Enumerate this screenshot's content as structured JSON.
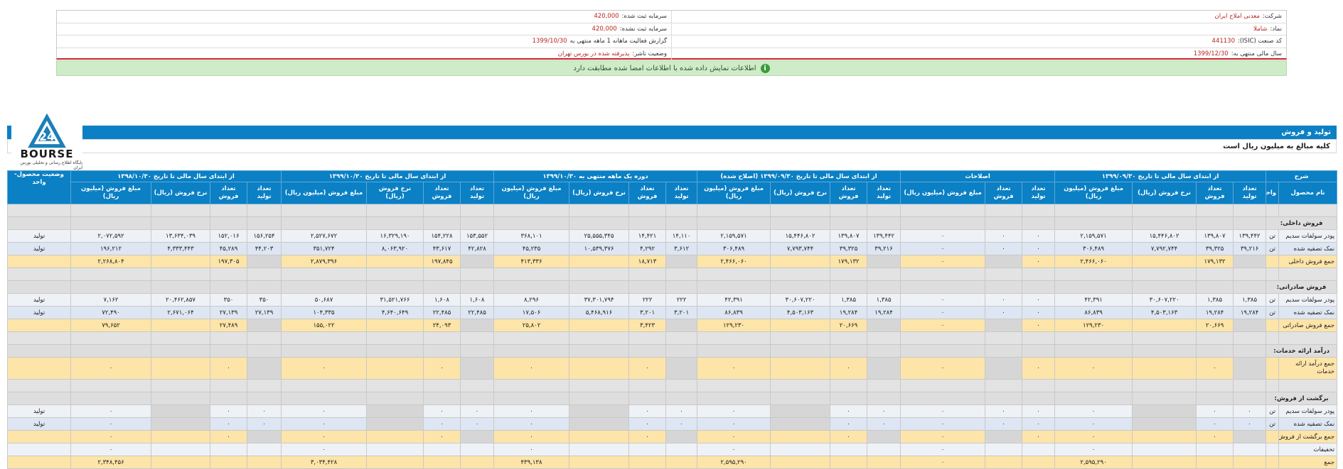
{
  "info": {
    "company_label": "شرکت:",
    "company_value": "معدنی املاح ایران",
    "capital_reg_label": "سرمایه ثبت شده:",
    "capital_reg_value": "420,000",
    "symbol_label": "نماد:",
    "symbol_value": "شاملا",
    "capital_unreg_label": "سرمایه ثبت نشده:",
    "capital_unreg_value": "420,000",
    "isic_label": "کد صنعت (ISIC):",
    "isic_value": "441130",
    "report_label": "گزارش فعالیت ماهانه 1 ماهه منتهی به",
    "report_value": "1399/10/30",
    "fiscal_label": "سال مالی منتهی به:",
    "fiscal_value": "1399/12/30",
    "status_label": "وضعیت ناشر:",
    "status_value": "پذیرفته شده در بورس تهران"
  },
  "notice": "اطلاعات نمایش داده شده با اطلاعات امضا شده مطابقت دارد",
  "logo": {
    "word": "BOURSE",
    "subtitle": "پایگاه اطلاع رسانی و تحلیلی بورس ایران",
    "glyph": "24"
  },
  "section": {
    "title": "تولید و فروش",
    "note": "کلیه مبالغ به میلیون ریال است"
  },
  "table": {
    "group_headers": {
      "desc": "شرح",
      "g1": "از ابتدای سال مالی تا تاریخ ۱۳۹۹/۰۹/۳۰",
      "g2": "اصلاحات",
      "g3": "از ابتدای سال مالی تا تاریخ ۱۳۹۹/۰۹/۳۰ (اصلاح شده)",
      "g4": "دوره یک ماهه منتهی به ۱۳۹۹/۱۰/۳۰",
      "g5": "از ابتدای سال مالی تا تاریخ ۱۳۹۹/۱۰/۳۰",
      "g6": "از ابتدای سال مالی تا تاریخ ۱۳۹۸/۱۰/۳۰",
      "status": "وضعیت محصول-واحد"
    },
    "sub_headers": {
      "product": "نام محصول",
      "unit": "واحد",
      "prod_qty": "تعداد تولید",
      "sale_qty": "تعداد فروش",
      "rate": "نرخ فروش (ریال)",
      "amount": "مبلغ فروش (میلیون ریال)"
    },
    "categories": {
      "domestic": "فروش داخلی:",
      "export": "فروش صادراتی:",
      "services": "درآمد ارائه خدمات:",
      "returns": "برگشت از فروش:"
    },
    "rows": {
      "dom1": [
        "پودر سولفات سدیم",
        "تن",
        "۱۳۹,۴۴۲",
        "۱۳۹,۸۰۷",
        "۱۵,۴۴۶,۸۰۲",
        "۲,۱۵۹,۵۷۱",
        "۰",
        "۰",
        "۰",
        "۱۳۹,۴۴۲",
        "۱۳۹,۸۰۷",
        "۱۵,۴۴۶,۸۰۲",
        "۲,۱۵۹,۵۷۱",
        "۱۴,۱۱۰",
        "۱۴,۴۲۱",
        "۲۵,۵۵۵,۳۴۵",
        "۳۶۸,۱۰۱",
        "۱۵۳,۵۵۲",
        "۱۵۴,۲۲۸",
        "۱۶,۳۲۹,۱۹۰",
        "۲,۵۲۷,۶۷۲",
        "۱۵۶,۲۵۴",
        "۱۵۲,۰۱۶",
        "۱۳,۶۳۴,۰۳۹",
        "۲,۰۷۲,۵۹۲",
        "تولید"
      ],
      "dom2": [
        "نمک تصفیه شده",
        "تن",
        "۳۹,۲۱۶",
        "۳۹,۳۲۵",
        "۷,۷۹۲,۷۴۴",
        "۳۰۶,۴۸۹",
        "۰",
        "۰",
        "۰",
        "۳۹,۲۱۶",
        "۳۹,۳۲۵",
        "۷,۷۹۳,۷۴۴",
        "۳۰۶,۴۸۹",
        "۳,۶۱۲",
        "۴,۲۹۲",
        "۱۰,۵۳۹,۳۷۶",
        "۴۵,۲۳۵",
        "۴۲,۸۲۸",
        "۴۳,۶۱۷",
        "۸,۰۶۳,۹۲۰",
        "۳۵۱,۷۲۴",
        "۴۴,۲۰۳",
        "۴۵,۲۸۹",
        "۴,۳۳۳,۴۴۳",
        "۱۹۶,۲۱۲",
        "تولید"
      ],
      "dom_sum": [
        "جمع فروش داخلی",
        "",
        "",
        "۱۷۹,۱۳۲",
        "",
        "۲,۴۶۶,۰۶۰",
        "۰",
        "",
        "۰",
        "",
        "۱۷۹,۱۳۲",
        "",
        "۲,۴۶۶,۰۶۰",
        "",
        "۱۸,۷۱۳",
        "",
        "۴۱۳,۳۳۶",
        "",
        "۱۹۷,۸۴۵",
        "",
        "۲,۸۷۹,۳۹۶",
        "",
        "۱۹۷,۳۰۵",
        "",
        "۲,۲۶۸,۸۰۴",
        ""
      ],
      "exp1": [
        "پودر سولفات سدیم",
        "تن",
        "۱,۳۸۵",
        "۱,۳۸۵",
        "۳۰,۶۰۷,۲۲۰",
        "۴۲,۳۹۱",
        "۰",
        "۰",
        "۰",
        "۱,۳۸۵",
        "۱,۳۸۵",
        "۳۰,۶۰۷,۲۲۰",
        "۴۲,۳۹۱",
        "۲۲۲",
        "۲۲۲",
        "۳۷,۳۰۱,۷۹۴",
        "۸,۲۹۶",
        "۱,۶۰۸",
        "۱,۶۰۸",
        "۳۱,۵۲۱,۷۶۶",
        "۵۰,۶۸۷",
        "۳۵۰",
        "۳۵۰",
        "۲۰,۴۶۲,۸۵۷",
        "۷,۱۶۲",
        "تولید"
      ],
      "exp2": [
        "نمک تصفیه شده",
        "تن",
        "۱۹,۲۸۴",
        "۱۹,۲۸۴",
        "۴,۵۰۳,۱۶۳",
        "۸۶,۸۳۹",
        "۰",
        "۰",
        "۰",
        "۱۹,۲۸۴",
        "۱۹,۲۸۴",
        "۴,۵۰۳,۱۶۳",
        "۸۶,۸۳۹",
        "۳,۲۰۱",
        "۳,۲۰۱",
        "۵,۴۶۸,۹۱۶",
        "۱۷,۵۰۶",
        "۲۲,۴۸۵",
        "۲۲,۴۸۵",
        "۴,۶۴۰,۶۴۹",
        "۱۰۴,۳۳۵",
        "۲۷,۱۳۹",
        "۲۷,۱۳۹",
        "۲,۶۷۱,۰۶۴",
        "۷۲,۴۹۰",
        "تولید"
      ],
      "exp_sum": [
        "جمع فروش صادراتی",
        "",
        "",
        "۲۰,۶۶۹",
        "",
        "۱۲۹,۲۳۰",
        "۰",
        "",
        "۰",
        "",
        "۲۰,۶۶۹",
        "",
        "۱۲۹,۲۳۰",
        "",
        "۳,۴۲۳",
        "",
        "۲۵,۸۰۲",
        "",
        "۲۴,۰۹۳",
        "",
        "۱۵۵,۰۲۲",
        "",
        "۲۷,۴۸۹",
        "",
        "۷۹,۶۵۲",
        ""
      ],
      "srv_sum": [
        "جمع درآمد ارائه خدمات",
        "",
        "",
        "۰",
        "",
        "۰",
        "۰",
        "",
        "۰",
        "",
        "۰",
        "",
        "۰",
        "",
        "۰",
        "",
        "۰",
        "",
        "۰",
        "",
        "۰",
        "",
        "۰",
        "",
        "۰",
        ""
      ],
      "ret1": [
        "پودر سولفات سدیم",
        "تن",
        "۰",
        "۰",
        "",
        "۰",
        "۰",
        "۰",
        "۰",
        "۰",
        "۰",
        "",
        "۰",
        "۰",
        "۰",
        "",
        "۰",
        "۰",
        "۰",
        "",
        "۰",
        "۰",
        "۰",
        "",
        "۰",
        "تولید"
      ],
      "ret2": [
        "نمک تصفیه شده",
        "تن",
        "۰",
        "۰",
        "",
        "۰",
        "۰",
        "۰",
        "۰",
        "۰",
        "۰",
        "",
        "۰",
        "۰",
        "۰",
        "",
        "۰",
        "۰",
        "۰",
        "",
        "۰",
        "۰",
        "۰",
        "",
        "۰",
        "تولید"
      ],
      "ret_sum": [
        "جمع برگشت از فروش",
        "",
        "",
        "۰",
        "",
        "۰",
        "۰",
        "",
        "۰",
        "",
        "۰",
        "",
        "۰",
        "",
        "۰",
        "",
        "۰",
        "",
        "۰",
        "",
        "۰",
        "",
        "۰",
        "",
        "۰",
        ""
      ],
      "disc": [
        "تخفیفات",
        "",
        "",
        "",
        "",
        "۰",
        "",
        "",
        "۰",
        "",
        "",
        "",
        "۰",
        "",
        "",
        "",
        "۰",
        "",
        "",
        "",
        "۰",
        "",
        "",
        "",
        "۰",
        ""
      ],
      "total": [
        "جمع",
        "",
        "",
        "",
        "",
        "۲,۵۹۵,۲۹۰",
        "",
        "",
        "۰",
        "",
        "",
        "",
        "۲,۵۹۵,۲۹۰",
        "",
        "",
        "",
        "۴۳۹,۱۳۸",
        "",
        "",
        "",
        "۳,۰۳۴,۴۲۸",
        "",
        "",
        "",
        "۲,۳۴۸,۴۵۶",
        ""
      ]
    }
  }
}
